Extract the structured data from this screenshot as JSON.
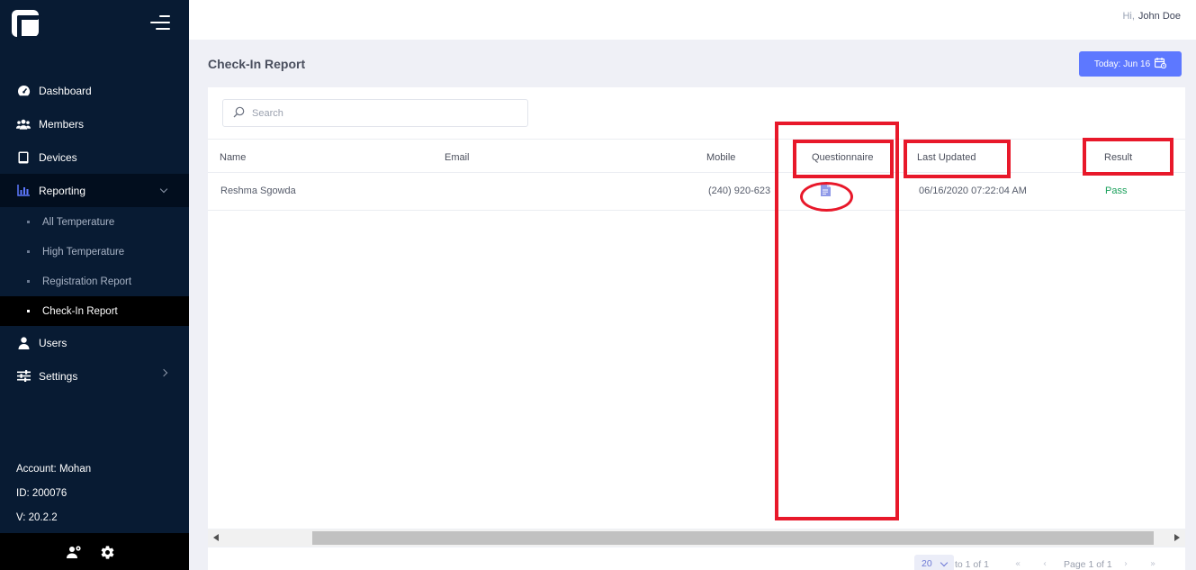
{
  "sidebar": {
    "items": [
      {
        "label": "Dashboard",
        "icon": "gauge-icon"
      },
      {
        "label": "Members",
        "icon": "users-icon"
      },
      {
        "label": "Devices",
        "icon": "tablet-icon"
      },
      {
        "label": "Reporting",
        "icon": "bar-chart-icon"
      },
      {
        "label": "Users",
        "icon": "user-icon"
      },
      {
        "label": "Settings",
        "icon": "sliders-icon"
      }
    ],
    "reporting_sub": [
      {
        "label": "All Temperature"
      },
      {
        "label": "High Temperature"
      },
      {
        "label": "Registration Report"
      },
      {
        "label": "Check-In Report"
      }
    ],
    "account": "Account: Mohan",
    "id": "ID: 200076",
    "version": "V: 20.2.2"
  },
  "topbar": {
    "hi": "Hi,",
    "user": "John Doe"
  },
  "page": {
    "title": "Check-In Report",
    "date_button": "Today: Jun 16"
  },
  "search": {
    "placeholder": "Search"
  },
  "table": {
    "headers": [
      "Name",
      "Email",
      "Mobile",
      "Questionnaire",
      "Last Updated",
      "Result"
    ],
    "rows": [
      {
        "name": "Reshma Sgowda",
        "email": "",
        "mobile": "(240) 920-623",
        "last_updated": "06/16/2020 07:22:04 AM",
        "result": "Pass"
      }
    ]
  },
  "pagination": {
    "page_size": "20",
    "range": "to 1 of 1",
    "page": "Page 1 of 1"
  },
  "colors": {
    "accent": "#5d78ff",
    "sidebar": "#081b33",
    "annotation": "#e8182a",
    "pass": "#1aa05b"
  }
}
